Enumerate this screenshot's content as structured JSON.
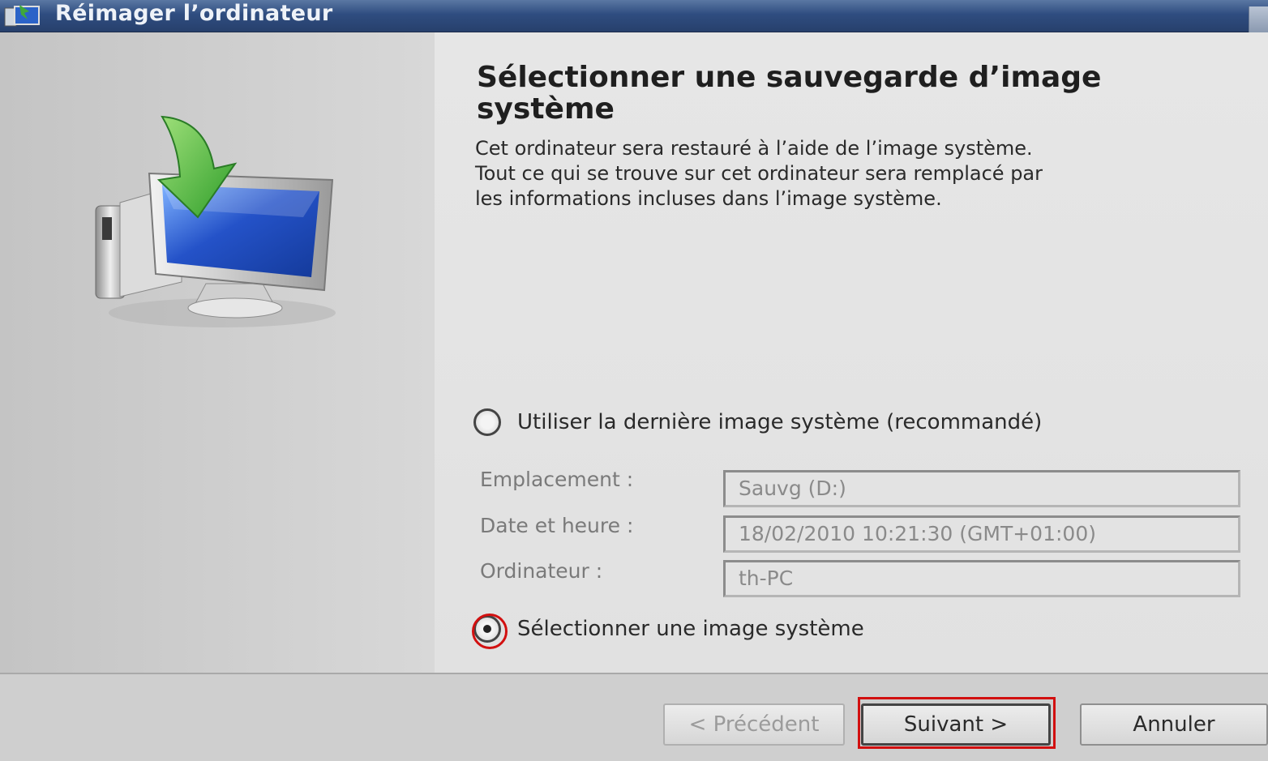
{
  "window": {
    "title": "Réimager l’ordinateur"
  },
  "content": {
    "heading": "Sélectionner une sauvegarde d’image système",
    "description_lines": [
      "Cet ordinateur sera restauré à l’aide de l’image système.",
      "Tout ce qui se trouve sur cet ordinateur sera remplacé par",
      "les informations incluses dans l’image système."
    ]
  },
  "options": {
    "use_latest": {
      "label": "Utiliser la dernière image système (recommandé)",
      "selected": false
    },
    "select_image": {
      "label": "Sélectionner une image système",
      "selected": true
    }
  },
  "details": {
    "location": {
      "label": "Emplacement :",
      "value": "Sauvg (D:)"
    },
    "datetime": {
      "label": "Date et heure :",
      "value": "18/02/2010 10:21:30 (GMT+01:00)"
    },
    "computer": {
      "label": "Ordinateur :",
      "value": "th-PC"
    }
  },
  "buttons": {
    "previous": "< Précédent",
    "next": "Suivant >",
    "cancel": "Annuler"
  },
  "colors": {
    "highlight": "#d21010",
    "titlebar": "#2f4d80"
  },
  "icons": {
    "window": "system-restore-icon",
    "hero": "reimage-computer-icon"
  }
}
